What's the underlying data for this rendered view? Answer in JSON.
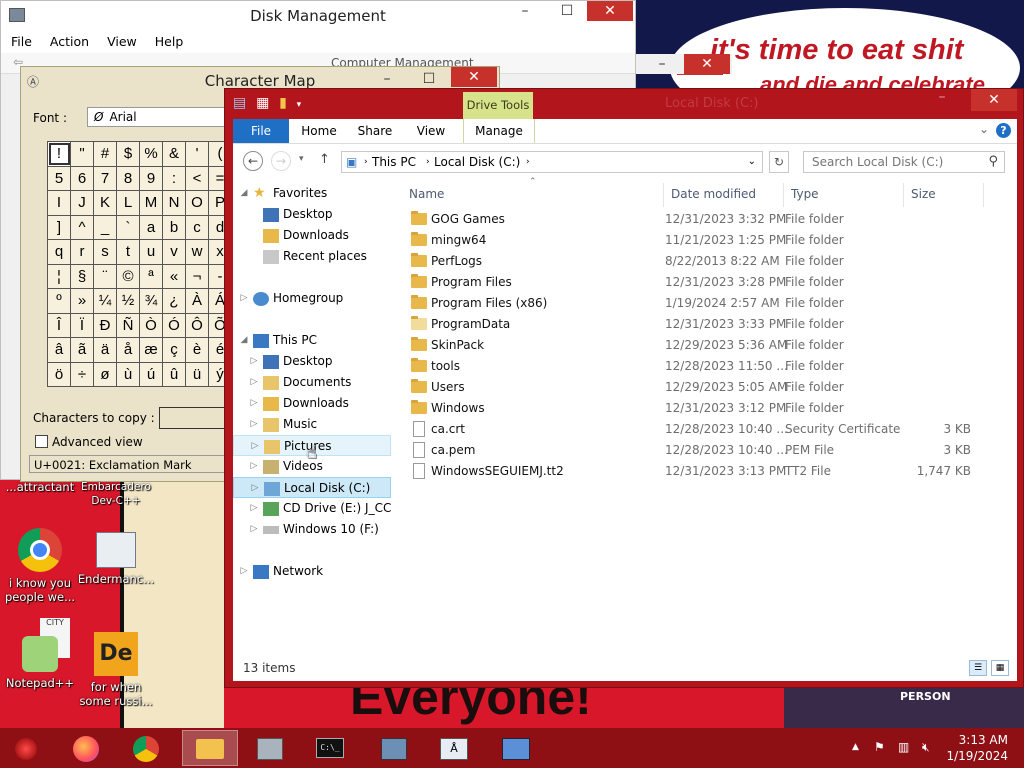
{
  "colors": {
    "explorer_frame": "#b3151c",
    "taskbar": "#8e1015",
    "file_tab": "#1f6fc5",
    "drive_tools": "#d6e38b"
  },
  "wallpaper": {
    "top_text_1": "it's time to eat shit",
    "top_text_2": "and die and celebrate",
    "bottom_text": "Everyone!",
    "side_text": "PERSON",
    "sign_text": "CITY"
  },
  "disk_management": {
    "title": "Disk Management",
    "menu": [
      "File",
      "Action",
      "View",
      "Help"
    ],
    "behind_title": "Computer Management"
  },
  "character_map": {
    "title": "Character Map",
    "font_label": "Font :",
    "font_value": "Arial",
    "grid": [
      [
        "!",
        "\"",
        "#",
        "$",
        "%",
        "&",
        "'",
        "("
      ],
      [
        "5",
        "6",
        "7",
        "8",
        "9",
        ":",
        "<",
        "="
      ],
      [
        "I",
        "J",
        "K",
        "L",
        "M",
        "N",
        "O",
        "P"
      ],
      [
        "]",
        "^",
        "_",
        "`",
        "a",
        "b",
        "c",
        "d"
      ],
      [
        "q",
        "r",
        "s",
        "t",
        "u",
        "v",
        "w",
        "x"
      ],
      [
        "¦",
        "§",
        "¨",
        "©",
        "ª",
        "«",
        "¬",
        "-"
      ],
      [
        "º",
        "»",
        "¼",
        "½",
        "¾",
        "¿",
        "À",
        "Á"
      ],
      [
        "Î",
        "Ï",
        "Ð",
        "Ñ",
        "Ò",
        "Ó",
        "Ô",
        "Õ"
      ],
      [
        "â",
        "ã",
        "ä",
        "å",
        "æ",
        "ç",
        "è",
        "é"
      ],
      [
        "ö",
        "÷",
        "ø",
        "ù",
        "ú",
        "û",
        "ü",
        "ý"
      ]
    ],
    "copy_label": "Characters to copy :",
    "advanced_view": "Advanced view",
    "status": "U+0021: Exclamation Mark"
  },
  "explorer": {
    "title": "Local Disk (C:)",
    "drive_tools": "Drive Tools",
    "tabs": [
      "File",
      "Home",
      "Share",
      "View",
      "Manage"
    ],
    "breadcrumb": [
      "This PC",
      "Local Disk (C:)"
    ],
    "search_placeholder": "Search Local Disk (C:)",
    "nav": {
      "favorites": "Favorites",
      "desktop": "Desktop",
      "downloads": "Downloads",
      "recent": "Recent places",
      "homegroup": "Homegroup",
      "this_pc": "This PC",
      "pc_desktop": "Desktop",
      "pc_documents": "Documents",
      "pc_downloads": "Downloads",
      "pc_music": "Music",
      "pc_pictures": "Pictures",
      "pc_videos": "Videos",
      "pc_local_disk": "Local Disk (C:)",
      "pc_cd_drive": "CD Drive (E:) J_CCSA",
      "pc_windows10": "Windows 10 (F:)",
      "network": "Network"
    },
    "columns": [
      "Name",
      "Date modified",
      "Type",
      "Size"
    ],
    "files": [
      {
        "name": "GOG Games",
        "date": "12/31/2023 3:32 PM",
        "type": "File folder",
        "size": "",
        "kind": "folder"
      },
      {
        "name": "mingw64",
        "date": "11/21/2023 1:25 PM",
        "type": "File folder",
        "size": "",
        "kind": "folder"
      },
      {
        "name": "PerfLogs",
        "date": "8/22/2013 8:22 AM",
        "type": "File folder",
        "size": "",
        "kind": "folder"
      },
      {
        "name": "Program Files",
        "date": "12/31/2023 3:28 PM",
        "type": "File folder",
        "size": "",
        "kind": "folder"
      },
      {
        "name": "Program Files (x86)",
        "date": "1/19/2024 2:57 AM",
        "type": "File folder",
        "size": "",
        "kind": "folder"
      },
      {
        "name": "ProgramData",
        "date": "12/31/2023 3:33 PM",
        "type": "File folder",
        "size": "",
        "kind": "folder-light"
      },
      {
        "name": "SkinPack",
        "date": "12/29/2023 5:36 AM",
        "type": "File folder",
        "size": "",
        "kind": "folder"
      },
      {
        "name": "tools",
        "date": "12/28/2023 11:50 ...",
        "type": "File folder",
        "size": "",
        "kind": "folder"
      },
      {
        "name": "Users",
        "date": "12/29/2023 5:05 AM",
        "type": "File folder",
        "size": "",
        "kind": "folder"
      },
      {
        "name": "Windows",
        "date": "12/31/2023 3:12 PM",
        "type": "File folder",
        "size": "",
        "kind": "folder"
      },
      {
        "name": "ca.crt",
        "date": "12/28/2023 10:40 ...",
        "type": "Security Certificate",
        "size": "3 KB",
        "kind": "file"
      },
      {
        "name": "ca.pem",
        "date": "12/28/2023 10:40 ...",
        "type": "PEM File",
        "size": "3 KB",
        "kind": "file"
      },
      {
        "name": "WindowsSEGUIEMJ.tt2",
        "date": "12/31/2023 3:13 PM",
        "type": "TT2 File",
        "size": "1,747 KB",
        "kind": "file"
      }
    ],
    "status": "13 items"
  },
  "desktop_icons": [
    {
      "label": "...attractant",
      "icon": "generic-icon"
    },
    {
      "label": "Embarcadero Dev-C++",
      "icon": "devcpp-icon"
    },
    {
      "label": "i know you people we...",
      "icon": "chrome-icon"
    },
    {
      "label": "Endermanc...",
      "icon": "app-window-icon"
    },
    {
      "label": "Notepad++",
      "icon": "notepadpp-icon"
    },
    {
      "label": "for when some russi...",
      "icon": "de-icon"
    }
  ],
  "taskbar": {
    "items": [
      "start-orb-icon",
      "firefox-icon",
      "chrome-icon",
      "file-explorer-icon",
      "disk-management-icon",
      "command-prompt-icon",
      "computer-management-icon",
      "character-map-icon",
      "remote-desktop-icon"
    ],
    "time": "3:13 AM",
    "date": "1/19/2024"
  }
}
